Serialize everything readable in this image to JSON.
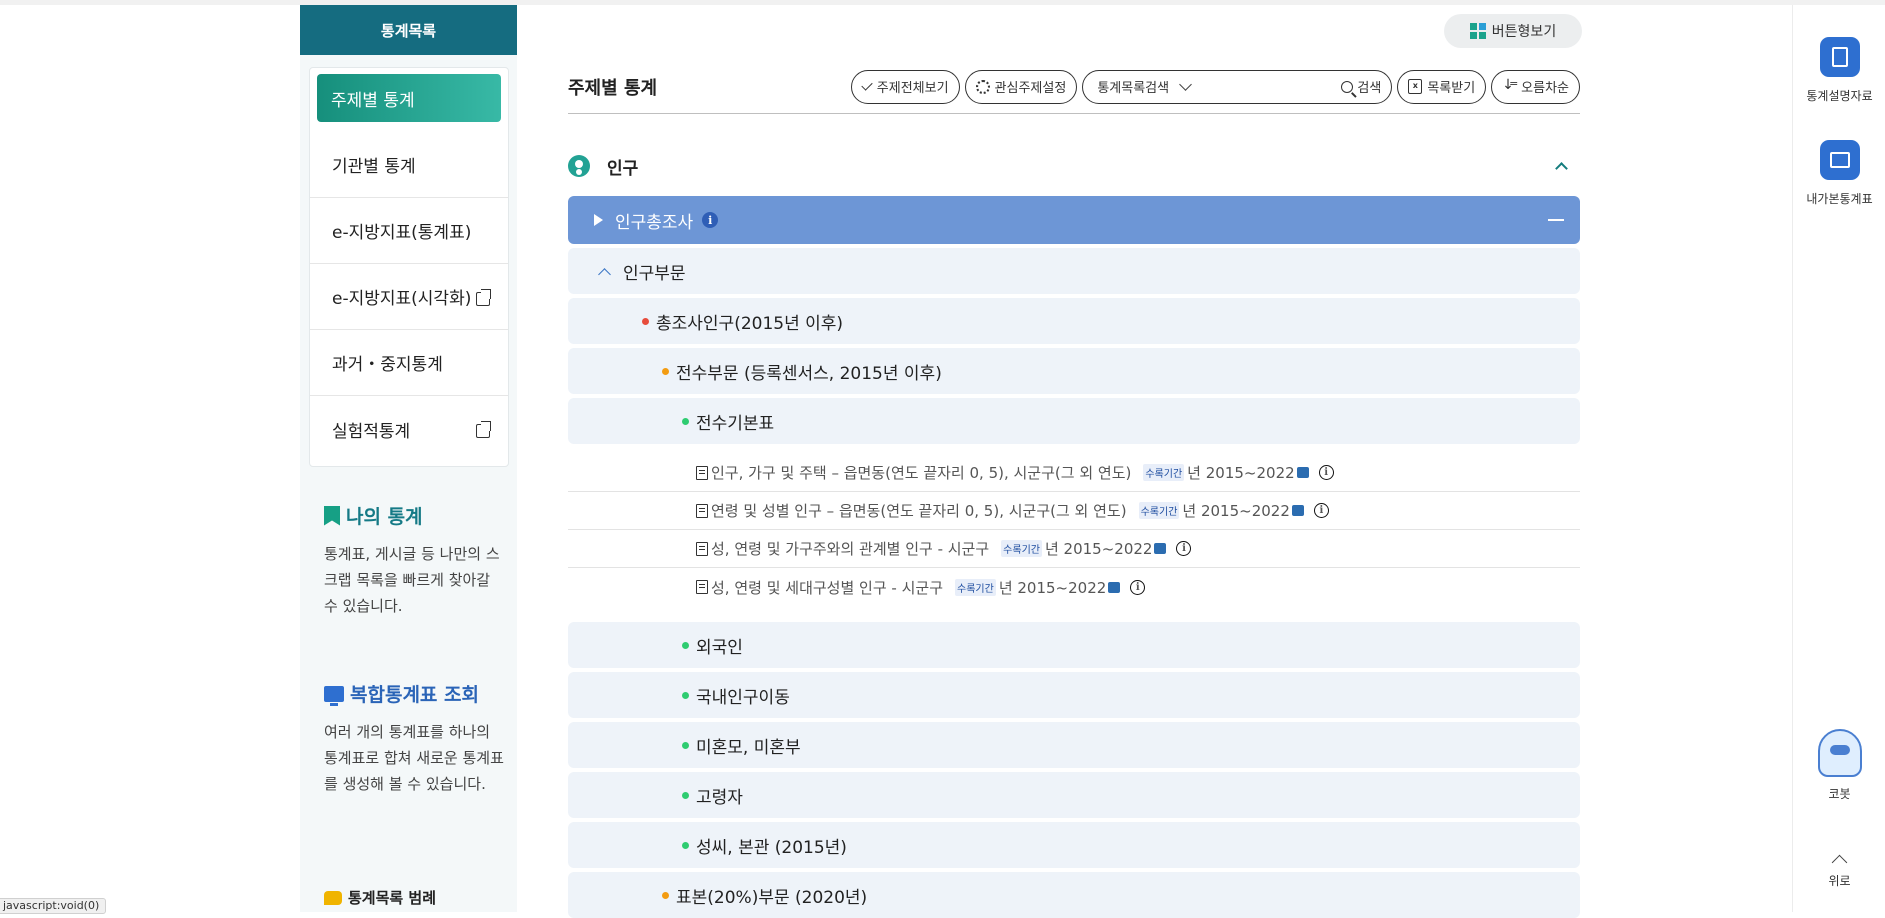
{
  "nav": {
    "header": "통계목록",
    "items": [
      {
        "label": "주제별 통계",
        "active": true
      },
      {
        "label": "기관별 통계"
      },
      {
        "label": "e-지방지표(통계표)"
      },
      {
        "label": "e-지방지표(시각화)",
        "external": true
      },
      {
        "label": "과거・중지통계"
      },
      {
        "label": "실험적통계",
        "external": true
      }
    ]
  },
  "promo": {
    "my_stats": {
      "title": "나의 통계",
      "desc": "통계표, 게시글 등 나만의 스크랩 목록을 빠르게 찾아갈 수 있습니다."
    },
    "composite": {
      "title": "복합통계표 조회",
      "desc": "여러 개의 통계표를 하나의 통계표로 합쳐 새로운 통계표를 생성해 볼 수 있습니다."
    },
    "legend": "통계목록 범례"
  },
  "header": {
    "view_button": "버튼형보기"
  },
  "toolbar": {
    "title": "주제별 통계",
    "view_all": "주제전체보기",
    "interest": "관심주제설정",
    "search_select": "통계목록검색",
    "search": "검색",
    "download": "목록받기",
    "sort": "오름차순"
  },
  "section": {
    "title": "인구",
    "census": "인구총조사",
    "population": "인구부문",
    "total": "총조사인구(2015년 이후)",
    "full": "전수부문 (등록센서스, 2015년 이후)",
    "basic": "전수기본표",
    "period_label": "수록기간",
    "tables": [
      {
        "title": "인구, 가구 및 주택 – 읍면동(연도 끝자리 0, 5), 시군구(그 외 연도)",
        "period": "년 2015~2022"
      },
      {
        "title": "연령 및 성별 인구 – 읍면동(연도 끝자리 0, 5), 시군구(그 외 연도)",
        "period": "년 2015~2022"
      },
      {
        "title": "성, 연령 및 가구주와의 관계별 인구 - 시군구",
        "period": "년 2015~2022"
      },
      {
        "title": "성, 연령 및 세대구성별 인구 - 시군구",
        "period": "년 2015~2022"
      }
    ],
    "others": [
      "외국인",
      "국내인구이동",
      "미혼모, 미혼부",
      "고령자",
      "성씨, 본관 (2015년)"
    ],
    "sample": "표본(20%)부문 (2020년)"
  },
  "rail": {
    "docs": "통계설명자료",
    "mytables": "내가본통계표",
    "robot": "코봇",
    "top": "위로"
  },
  "status": "javascript:void(0)"
}
